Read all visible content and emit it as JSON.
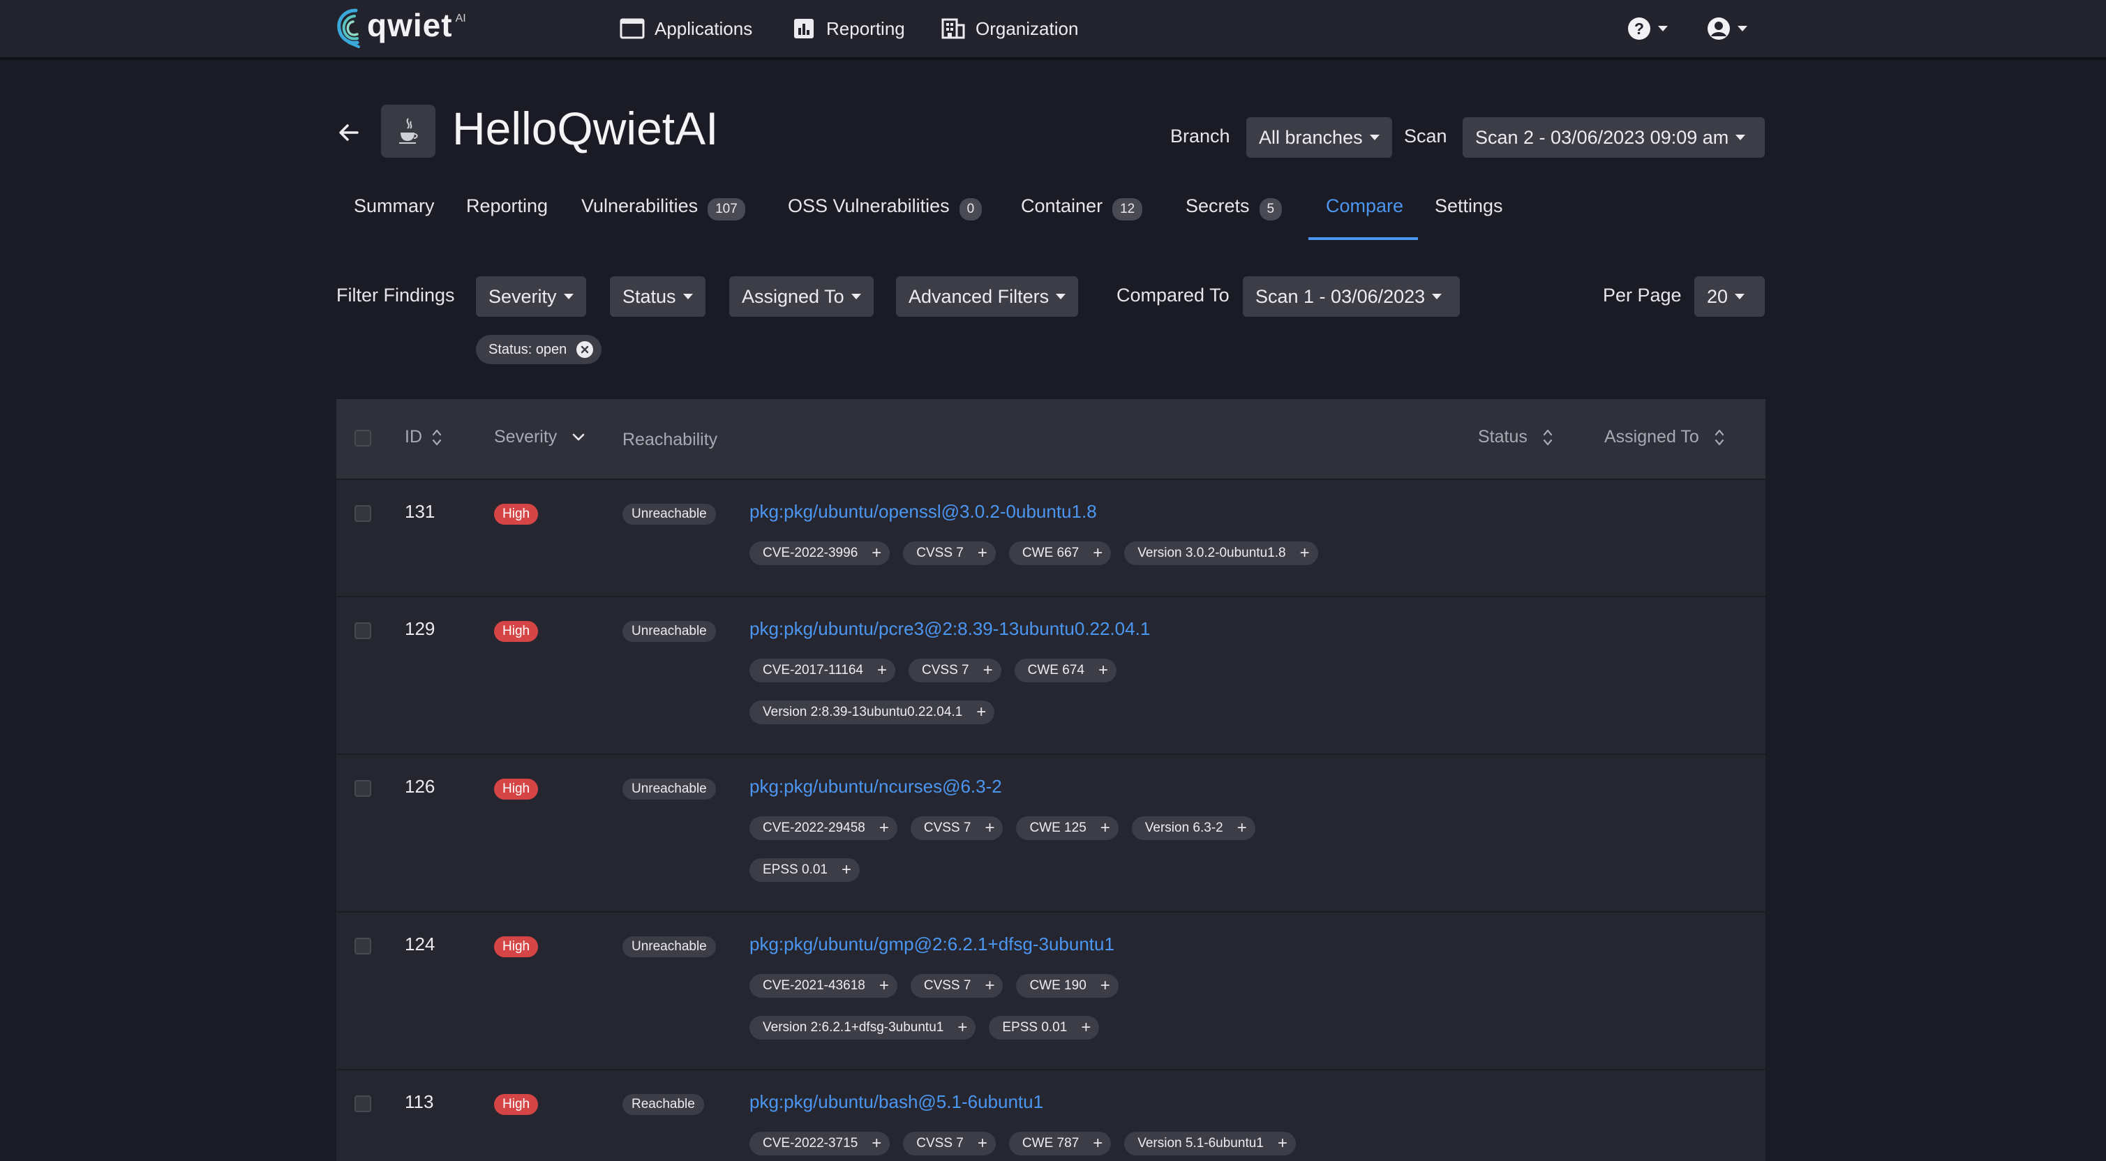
{
  "brand": {
    "name": "qwiet",
    "suffix": "AI"
  },
  "topnav": {
    "applications": "Applications",
    "reporting": "Reporting",
    "organization": "Organization"
  },
  "header": {
    "app_name": "HelloQwietAI",
    "branch_label": "Branch",
    "branch_value": "All branches",
    "scan_label": "Scan",
    "scan_value": "Scan 2 - 03/06/2023 09:09 am"
  },
  "tabs": [
    {
      "label": "Summary",
      "badge": ""
    },
    {
      "label": "Reporting",
      "badge": ""
    },
    {
      "label": "Vulnerabilities",
      "badge": "107"
    },
    {
      "label": "OSS Vulnerabilities",
      "badge": "0"
    },
    {
      "label": "Container",
      "badge": "12"
    },
    {
      "label": "Secrets",
      "badge": "5"
    },
    {
      "label": "Compare",
      "badge": ""
    },
    {
      "label": "Settings",
      "badge": ""
    }
  ],
  "filters": {
    "label": "Filter Findings",
    "severity": "Severity",
    "status": "Status",
    "assigned": "Assigned To",
    "advanced": "Advanced Filters",
    "compared_label": "Compared To",
    "compared_value": "Scan 1 - 03/06/2023",
    "per_page_label": "Per Page",
    "per_page_value": "20",
    "active_chip": "Status: open"
  },
  "table": {
    "headers": {
      "id": "ID",
      "severity": "Severity",
      "reachability": "Reachability",
      "status": "Status",
      "assigned": "Assigned To"
    },
    "rows": [
      {
        "id": "131",
        "severity": "High",
        "reachability": "Unreachable",
        "package": "pkg:pkg/ubuntu/openssl@3.0.2-0ubuntu1.8",
        "tags": [
          "CVE-2022-3996",
          "CVSS 7",
          "CWE 667",
          "Version 3.0.2-0ubuntu1.8"
        ]
      },
      {
        "id": "129",
        "severity": "High",
        "reachability": "Unreachable",
        "package": "pkg:pkg/ubuntu/pcre3@2:8.39-13ubuntu0.22.04.1",
        "tags": [
          "CVE-2017-11164",
          "CVSS 7",
          "CWE 674",
          "Version 2:8.39-13ubuntu0.22.04.1"
        ]
      },
      {
        "id": "126",
        "severity": "High",
        "reachability": "Unreachable",
        "package": "pkg:pkg/ubuntu/ncurses@6.3-2",
        "tags": [
          "CVE-2022-29458",
          "CVSS 7",
          "CWE 125",
          "Version 6.3-2",
          "EPSS 0.01"
        ]
      },
      {
        "id": "124",
        "severity": "High",
        "reachability": "Unreachable",
        "package": "pkg:pkg/ubuntu/gmp@2:6.2.1+dfsg-3ubuntu1",
        "tags": [
          "CVE-2021-43618",
          "CVSS 7",
          "CWE 190",
          "Version 2:6.2.1+dfsg-3ubuntu1",
          "EPSS 0.01"
        ]
      },
      {
        "id": "113",
        "severity": "High",
        "reachability": "Reachable",
        "package": "pkg:pkg/ubuntu/bash@5.1-6ubuntu1",
        "tags": [
          "CVE-2022-3715",
          "CVSS 7",
          "CWE 787",
          "Version 5.1-6ubuntu1"
        ]
      }
    ]
  },
  "colors": {
    "accent": "#4b96f0",
    "severity_high": "#d64545",
    "background": "#1b1b26"
  }
}
